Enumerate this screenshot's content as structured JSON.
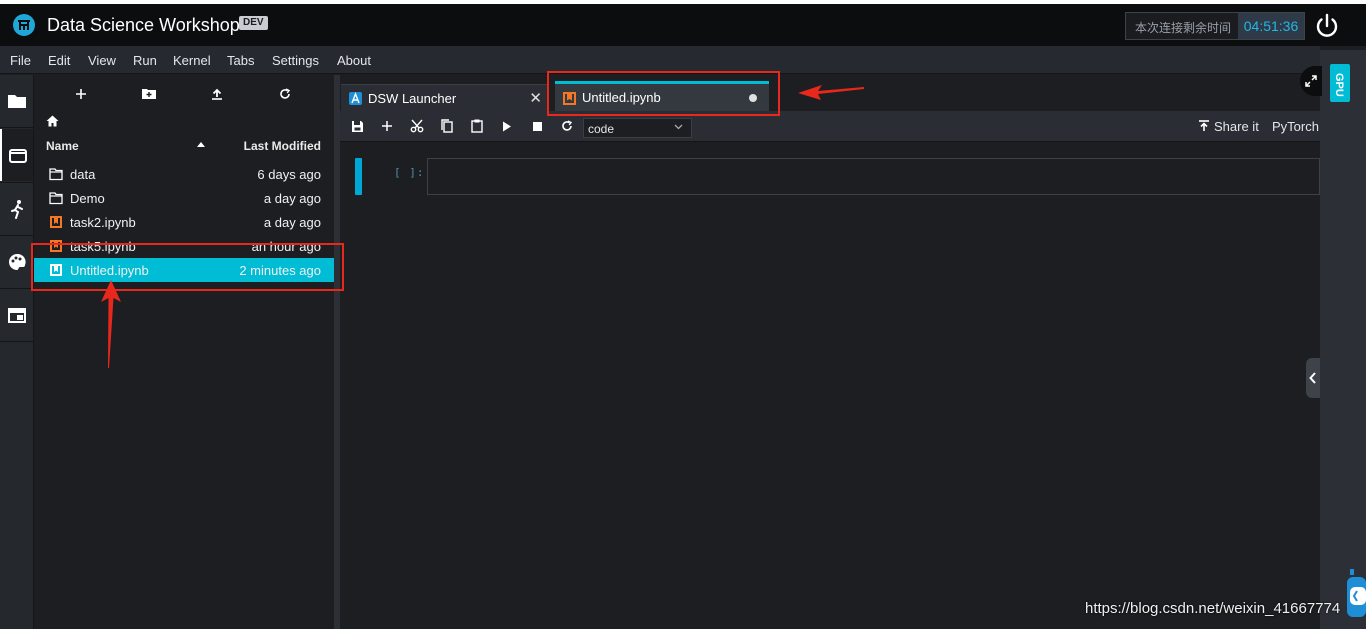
{
  "titlebar": {
    "app_title": "Data Science Workshop",
    "badge": "DEV",
    "timer_label": "本次连接剩余时间",
    "timer_value": "04:51:36"
  },
  "menu": [
    "File",
    "Edit",
    "View",
    "Run",
    "Kernel",
    "Tabs",
    "Settings",
    "About"
  ],
  "filebrowser": {
    "header_name": "Name",
    "header_modified": "Last Modified",
    "files": [
      {
        "name": "data",
        "modified": "6 days ago",
        "type": "folder"
      },
      {
        "name": "Demo",
        "modified": "a day ago",
        "type": "folder"
      },
      {
        "name": "task2.ipynb",
        "modified": "a day ago",
        "type": "notebook"
      },
      {
        "name": "task5.ipynb",
        "modified": "an hour ago",
        "type": "notebook"
      },
      {
        "name": "Untitled.ipynb",
        "modified": "2 minutes ago",
        "type": "notebook",
        "selected": true
      }
    ]
  },
  "tabs": [
    {
      "label": "DSW Launcher",
      "active": false
    },
    {
      "label": "Untitled.ipynb",
      "active": true
    }
  ],
  "toolbar": {
    "cell_type": "code",
    "share_label": "Share it",
    "kernel_name": "PyTorch"
  },
  "cell": {
    "prompt": "[ ]:"
  },
  "sidepanel": {
    "gpu_label": "GPU"
  },
  "watermark": "https://blog.csdn.net/weixin_41667774",
  "colors": {
    "accent": "#00bcd4",
    "annotation": "#e8281c",
    "background": "#1c1e22"
  }
}
